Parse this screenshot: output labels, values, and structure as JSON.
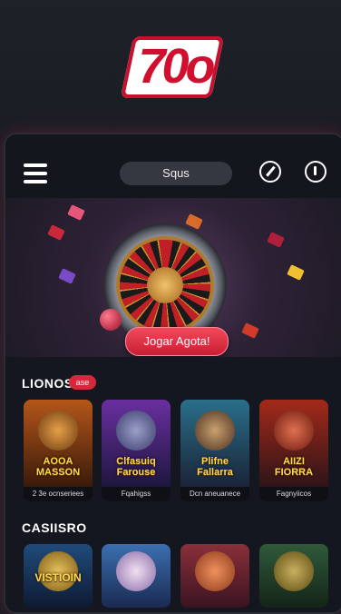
{
  "brand": {
    "logo_text": "70o"
  },
  "topbar": {
    "search_label": "Squs"
  },
  "hero": {
    "cta_label": "Jogar Agota!"
  },
  "section1": {
    "title": "LIONOS",
    "badge": "ase",
    "cards": [
      {
        "art_title": "AOOA MASSON",
        "caption": "2 3e ocnseriees",
        "colors": [
          "#b5561a",
          "#3a1a0a"
        ]
      },
      {
        "art_title": "Clfasuiq Farouse",
        "caption": "Fqahigss",
        "colors": [
          "#6a2fa0",
          "#1e1640"
        ]
      },
      {
        "art_title": "Plifne Fallarra",
        "caption": "Dcn aneuanece",
        "colors": [
          "#2a6f8a",
          "#1a2438"
        ]
      },
      {
        "art_title": "AIIZI FIORRA",
        "caption": "Fagnyiicos",
        "colors": [
          "#a32a1a",
          "#2e1418"
        ]
      }
    ]
  },
  "section2": {
    "title": "CASIISRO",
    "cards": [
      {
        "art_title": "VISTIOIN",
        "colors": [
          "#1f4b7a",
          "#0f1a33"
        ]
      },
      {
        "art_title": "",
        "colors": [
          "#3b6fb0",
          "#1a2a52"
        ]
      },
      {
        "art_title": "",
        "colors": [
          "#8a2f3a",
          "#3a1420"
        ]
      },
      {
        "art_title": "",
        "colors": [
          "#2f5a3a",
          "#152418"
        ]
      }
    ]
  }
}
